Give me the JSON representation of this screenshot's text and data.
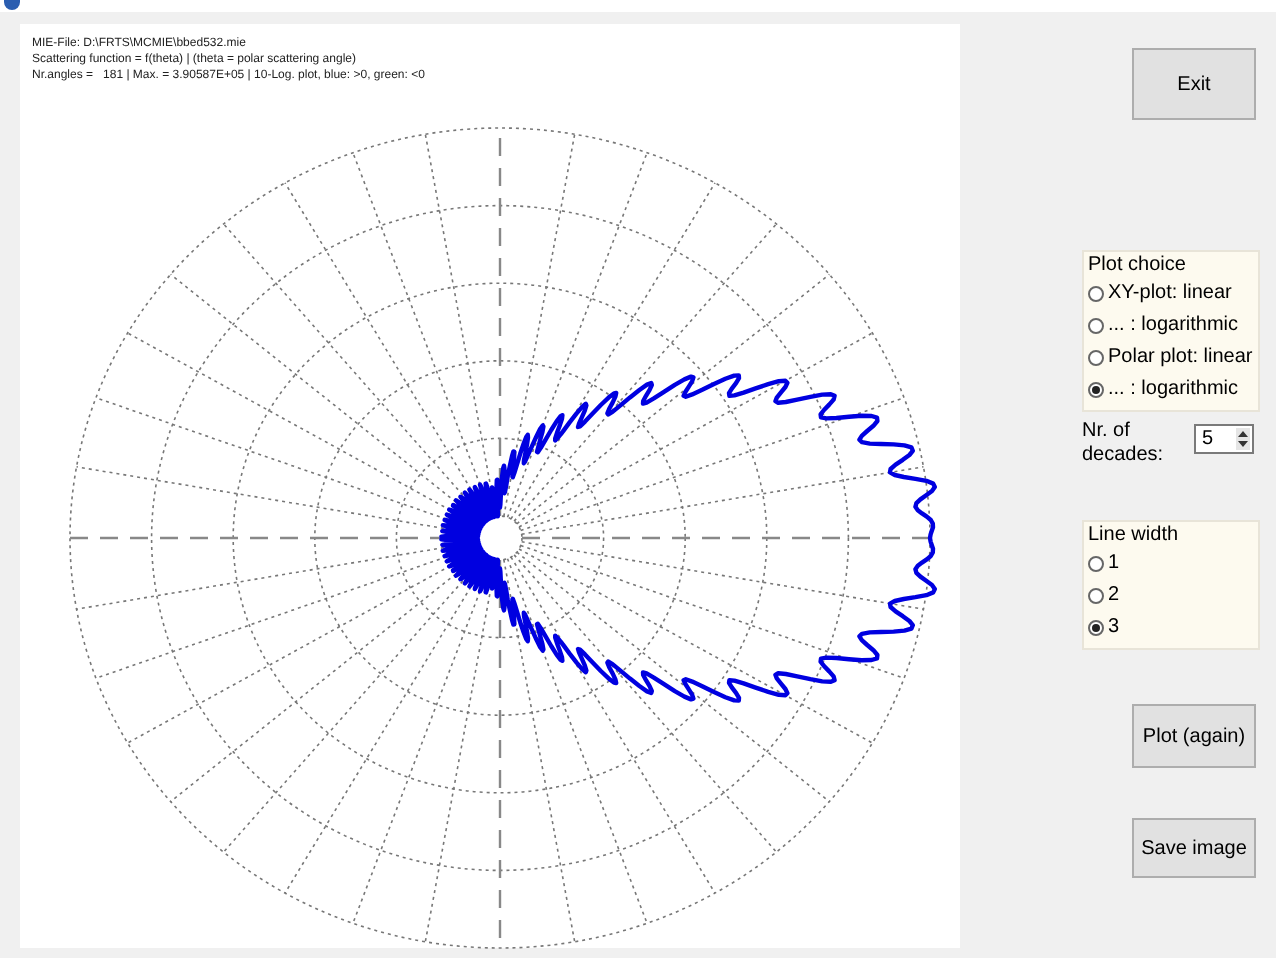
{
  "plot": {
    "info_lines": [
      "MIE-File: D:\\FRTS\\MCMIE\\bbed532.mie",
      "Scattering function = f(theta) | (theta = polar scattering angle)",
      "Nr.angles =   181 | Max. = 3.90587E+05 | 10-Log. plot, blue: >0, green: <0"
    ]
  },
  "exit_button": "Exit",
  "plot_choice": {
    "title": "Plot choice",
    "options": [
      {
        "label": "XY-plot: linear",
        "selected": false
      },
      {
        "label": "... : logarithmic",
        "selected": false
      },
      {
        "label": "Polar plot: linear",
        "selected": false
      },
      {
        "label": "... : logarithmic",
        "selected": true
      }
    ]
  },
  "decades": {
    "label": "Nr. of decades:",
    "value": "5"
  },
  "line_width": {
    "title": "Line width",
    "options": [
      {
        "label": "1",
        "selected": false
      },
      {
        "label": "2",
        "selected": false
      },
      {
        "label": "3",
        "selected": true
      }
    ]
  },
  "buttons": [
    "Plot (again)",
    "Save image"
  ]
}
